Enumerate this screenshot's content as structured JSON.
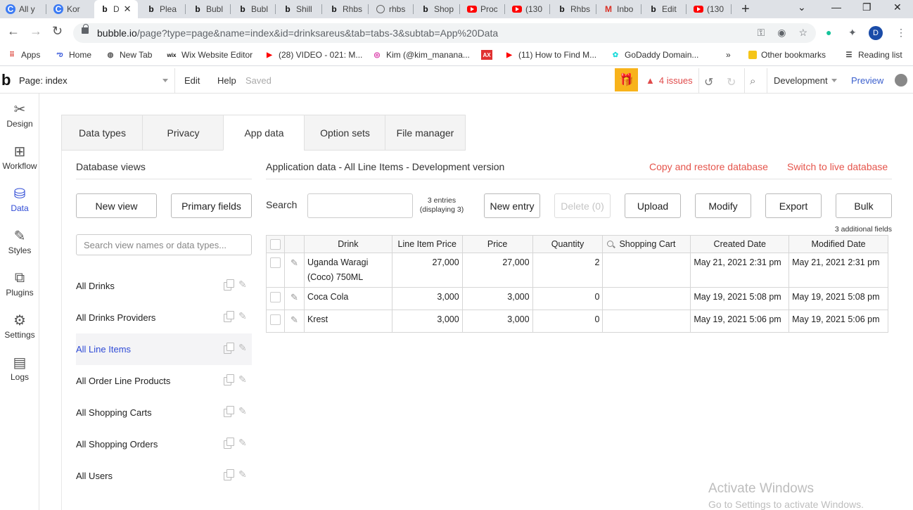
{
  "browser": {
    "tabs": [
      {
        "title": "All y",
        "icon": "c"
      },
      {
        "title": "Kor",
        "icon": "c"
      },
      {
        "title": "D",
        "icon": "b",
        "active": true
      },
      {
        "title": "Plea",
        "icon": "b"
      },
      {
        "title": "Bubl",
        "icon": "b"
      },
      {
        "title": "Bubl",
        "icon": "b"
      },
      {
        "title": "Shill",
        "icon": "b"
      },
      {
        "title": "Rhbs",
        "icon": "b"
      },
      {
        "title": "rhbs",
        "icon": "globe"
      },
      {
        "title": "Shop",
        "icon": "b"
      },
      {
        "title": "Proc",
        "icon": "yt"
      },
      {
        "title": "(130",
        "icon": "yt"
      },
      {
        "title": "Rhbs",
        "icon": "b"
      },
      {
        "title": "Inbo",
        "icon": "m"
      },
      {
        "title": "Edit",
        "icon": "b"
      },
      {
        "title": "(130",
        "icon": "yt"
      }
    ],
    "url_host": "bubble.io",
    "url_path": "/page?type=page&name=index&id=drinksareus&tab=tabs-3&subtab=App%20Data",
    "profile_initial": "D",
    "bookmarks": [
      {
        "label": "Apps",
        "icon": "apps"
      },
      {
        "label": "Home",
        "icon": "home"
      },
      {
        "label": "New Tab",
        "icon": "globe"
      },
      {
        "label": "Wix Website Editor",
        "icon": "wix"
      },
      {
        "label": "(28) VIDEO - 021: M...",
        "icon": "yt"
      },
      {
        "label": "Kim (@kim_manana...",
        "icon": "instagram"
      },
      {
        "label": "",
        "icon": "ax"
      },
      {
        "label": "(11) How to Find M...",
        "icon": "yt"
      },
      {
        "label": "GoDaddy Domain...",
        "icon": "godaddy"
      }
    ],
    "bookmarks_more": "»",
    "other_bookmarks": "Other bookmarks",
    "reading_list": "Reading list"
  },
  "editor": {
    "page_label": "Page: index",
    "menu_edit": "Edit",
    "menu_help": "Help",
    "saved": "Saved",
    "issues": "4 issues",
    "environment": "Development",
    "preview": "Preview"
  },
  "sidenav": [
    {
      "label": "Design",
      "icon": "design-icon"
    },
    {
      "label": "Workflow",
      "icon": "workflow-icon"
    },
    {
      "label": "Data",
      "icon": "data-icon",
      "active": true
    },
    {
      "label": "Styles",
      "icon": "styles-icon"
    },
    {
      "label": "Plugins",
      "icon": "plugins-icon"
    },
    {
      "label": "Settings",
      "icon": "settings-icon"
    },
    {
      "label": "Logs",
      "icon": "logs-icon"
    }
  ],
  "data_tabs": [
    "Data types",
    "Privacy",
    "App data",
    "Option sets",
    "File manager"
  ],
  "database_views": {
    "title": "Database views",
    "new_view": "New view",
    "primary_fields": "Primary fields",
    "search_placeholder": "Search view names or data types...",
    "items": [
      "All Drinks",
      "All Drinks Providers",
      "All Line Items",
      "All Order Line Products",
      "All Shopping Carts",
      "All Shopping Orders",
      "All Users"
    ],
    "active_index": 2
  },
  "app_data": {
    "title": "Application data - All Line Items - Development version",
    "copy_restore": "Copy and restore database",
    "switch_live": "Switch to live database",
    "search_label": "Search",
    "entries_line1": "3 entries",
    "entries_line2": "(displaying 3)",
    "buttons": {
      "new_entry": "New entry",
      "delete": "Delete (0)",
      "upload": "Upload",
      "modify": "Modify",
      "export": "Export",
      "bulk": "Bulk"
    },
    "additional_fields": "3 additional fields",
    "columns": [
      "Drink",
      "Line Item Price",
      "Price",
      "Quantity",
      "Shopping Cart",
      "Created Date",
      "Modified Date"
    ],
    "rows": [
      {
        "drink": "Uganda Waragi (Coco) 750ML",
        "line_item_price": "27,000",
        "price": "27,000",
        "quantity": "2",
        "shopping_cart": "",
        "created": "May 21, 2021 2:31 pm",
        "modified": "May 21, 2021 2:31 pm"
      },
      {
        "drink": "Coca Cola",
        "line_item_price": "3,000",
        "price": "3,000",
        "quantity": "0",
        "shopping_cart": "",
        "created": "May 19, 2021 5:08 pm",
        "modified": "May 19, 2021 5:08 pm"
      },
      {
        "drink": "Krest",
        "line_item_price": "3,000",
        "price": "3,000",
        "quantity": "0",
        "shopping_cart": "",
        "created": "May 19, 2021 5:06 pm",
        "modified": "May 19, 2021 5:06 pm"
      }
    ]
  },
  "watermark": {
    "line1": "Activate Windows",
    "line2": "Go to Settings to activate Windows."
  },
  "colors": {
    "accent_blue": "#2f4bd6",
    "danger_red": "#e5544b",
    "gift_yellow": "#f8b31b"
  }
}
